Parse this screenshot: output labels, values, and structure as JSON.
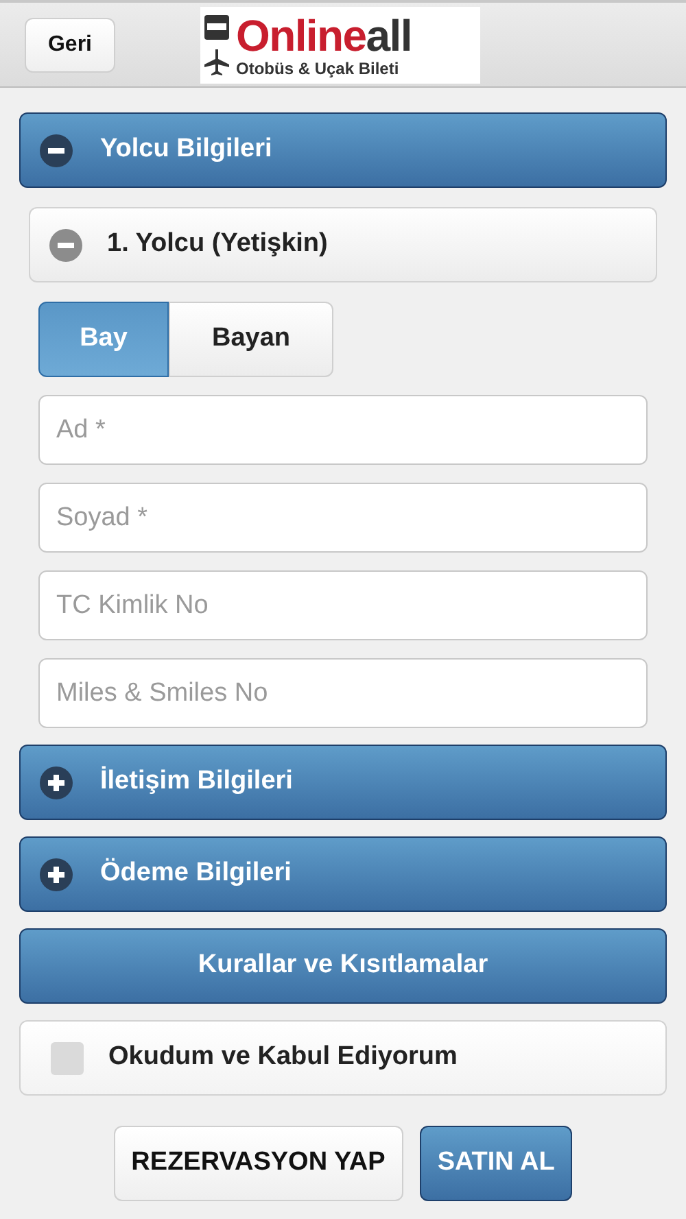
{
  "header": {
    "back_button": "Geri",
    "logo": {
      "brand_primary": "Online",
      "brand_secondary": "all",
      "tagline": "Otobüs & Uçak Bileti"
    }
  },
  "sections": [
    {
      "title": "Yolcu Bilgileri",
      "expanded": true,
      "passengers": [
        {
          "title": "1. Yolcu (Yetişkin)",
          "expanded": true,
          "gender_options": [
            {
              "label": "Bay",
              "selected": true
            },
            {
              "label": "Bayan",
              "selected": false
            }
          ],
          "fields": [
            {
              "placeholder": "Ad *"
            },
            {
              "placeholder": "Soyad *"
            },
            {
              "placeholder": "TC Kimlik No"
            },
            {
              "placeholder": "Miles & Smiles No"
            }
          ]
        }
      ]
    },
    {
      "title": "İletişim Bilgileri",
      "expanded": false
    },
    {
      "title": "Ödeme Bilgileri",
      "expanded": false
    }
  ],
  "rules_button": "Kurallar ve Kısıtlamalar",
  "agreement": {
    "label": "Okudum ve Kabul Ediyorum",
    "checked": false
  },
  "actions": [
    {
      "label": "REZERVASYON YAP",
      "kind": "secondary"
    },
    {
      "label": "SATIN AL",
      "kind": "primary"
    }
  ]
}
